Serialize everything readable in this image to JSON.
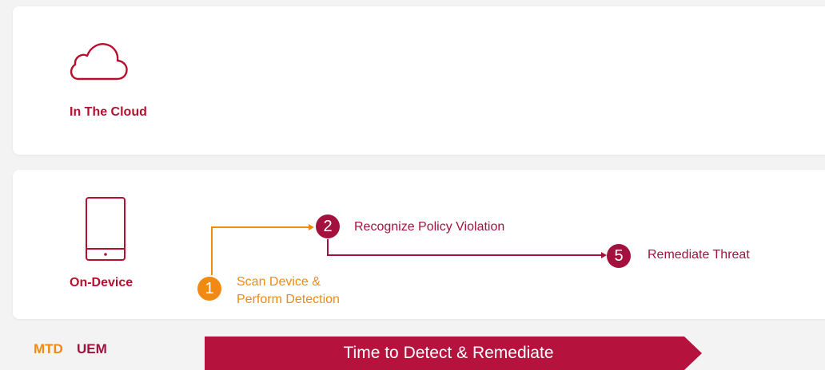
{
  "zones": {
    "cloud": {
      "label": "In The Cloud",
      "icon": "cloud-icon"
    },
    "device": {
      "label": "On-Device",
      "icon": "tablet-icon"
    }
  },
  "steps": [
    {
      "number": "1",
      "label_line1": "Scan Device &",
      "label_line2": "Perform Detection",
      "color": "#f08a12"
    },
    {
      "number": "2",
      "label": "Recognize Policy Violation",
      "color": "#a3123e"
    },
    {
      "number": "5",
      "label": "Remediate Threat",
      "color": "#a3123e"
    }
  ],
  "legend": {
    "mtd": {
      "label": "MTD",
      "color": "#f08a12"
    },
    "uem": {
      "label": "UEM",
      "color": "#a3123e"
    }
  },
  "timeline": {
    "label": "Time to Detect & Remediate",
    "color": "#b5123e"
  },
  "colors": {
    "brand_red": "#b5102e",
    "orange": "#f08a12",
    "crimson": "#a3123e"
  }
}
